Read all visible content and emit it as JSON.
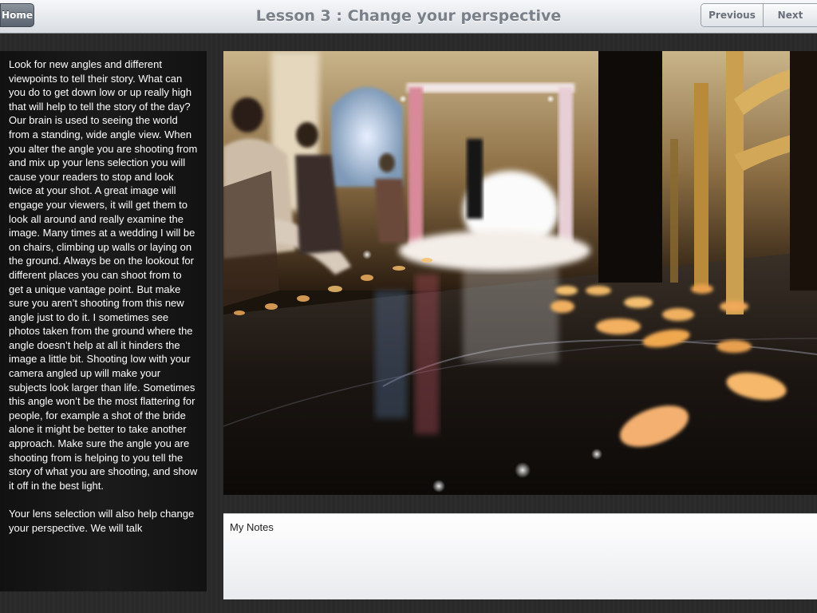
{
  "navbar": {
    "home_label": "Home",
    "title": "Lesson 3 : Change your perspective",
    "previous_label": "Previous",
    "next_label": "Next"
  },
  "lesson": {
    "paragraphs": [
      "Look for new angles and different viewpoints to tell their story.  What can you do to get down low or up really high that will help to tell the story of the day?  Our brain is used to seeing the world from a standing, wide angle view.  When you alter the angle you are shooting from and mix up your lens selection you will cause your readers to stop and look twice at your shot.  A great image will engage your viewers, it will get them to look all around and really examine the image.  Many times at a wedding I will be on chairs, climbing up walls or laying on the ground.  Always be on the lookout for different places you can shoot from to get a unique vantage point.  But make sure you aren’t shooting from this new angle just to do it.  I sometimes see photos taken from the ground where the angle doesn’t help at all it hinders the image a little bit.  Shooting low with your camera angled up will make your subjects look larger than life.  Sometimes this angle won’t be the most flattering for people, for example a shot of the bride alone it might be better to take another approach.  Make sure the angle you are shooting from is helping to you tell the story of what you are shooting, and show it off in the best light.",
      "Your lens selection will also help change your perspective.  We will talk"
    ]
  },
  "notes": {
    "label": "My Notes",
    "value": ""
  }
}
